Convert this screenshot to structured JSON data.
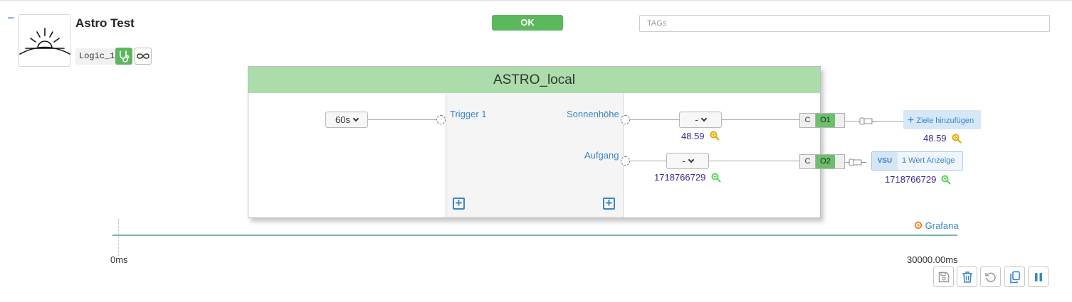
{
  "header": {
    "collapse_glyph": "−",
    "logo_icon": "sunrise-icon",
    "title": "Astro Test",
    "logic_tag": "Logic_1",
    "debug_icon": "stethoscope-icon",
    "loop_icon": "infinity-icon",
    "ok_label": "OK",
    "tags_placeholder": "TAGs"
  },
  "node": {
    "title": "ASTRO_local",
    "interval": "60s",
    "trigger_label": "Trigger 1",
    "outputs": [
      {
        "label": "Sonnenhöhe",
        "select": "-",
        "value": "48.59",
        "c_label": "C",
        "o_label": "O1"
      },
      {
        "label": "Aufgang",
        "select": "-",
        "value": "1718766729",
        "c_label": "C",
        "o_label": "O2"
      }
    ]
  },
  "targets": {
    "add_label": "Ziele hinzufügen",
    "add_value": "48.59",
    "vsu_tag": "VSU",
    "vsu_label": "1 Wert Anzeige",
    "vsu_value": "1718766729"
  },
  "timeline": {
    "grafana_label": "Grafana",
    "start_label": "0ms",
    "end_label": "30000.00ms"
  },
  "toolbar": {
    "icons": [
      "save-icon",
      "trash-icon",
      "undo-icon",
      "copy-icon",
      "pause-icon"
    ]
  },
  "colors": {
    "accent_green": "#5cb85c",
    "header_green": "#acdcac",
    "link_blue": "#3a85c8",
    "value_purple": "#3a2a90",
    "zoom_yellow": "#e0a800",
    "zoom_green": "#5cd65c"
  }
}
